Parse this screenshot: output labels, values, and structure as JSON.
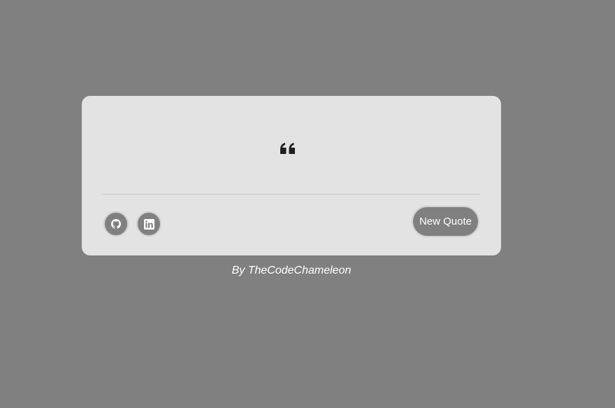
{
  "colors": {
    "page_background": "#808080",
    "card_background": "#e3e3e3",
    "button_background": "#808080",
    "button_border": "#cfcfcf",
    "quote_icon": "#1f1f1f",
    "divider": "#cbcbcb"
  },
  "quote": {
    "icon": "quote-left-icon",
    "text": "",
    "author": ""
  },
  "social": {
    "github_icon": "github-icon",
    "linkedin_icon": "linkedin-icon"
  },
  "button": {
    "label": "New Quote"
  },
  "footer": {
    "credit": "By TheCodeChameleon"
  }
}
